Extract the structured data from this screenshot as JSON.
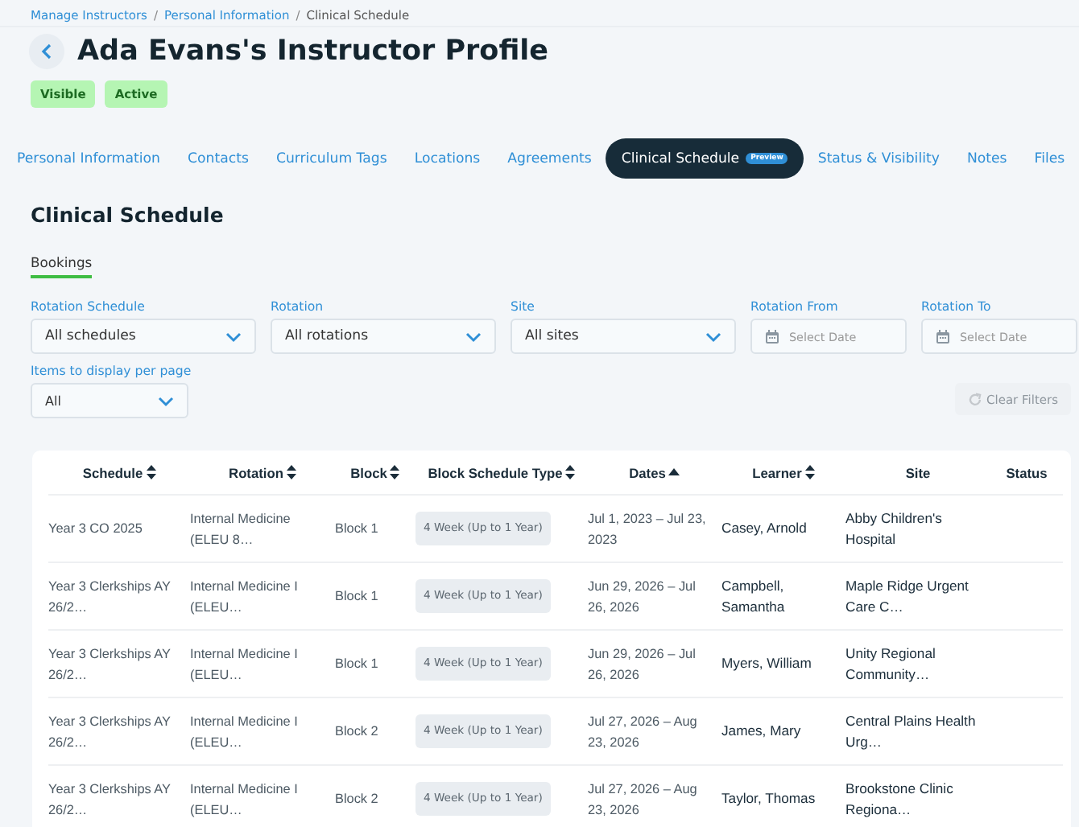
{
  "breadcrumbs": [
    {
      "kind": "link",
      "label": "Manage Instructors"
    },
    {
      "kind": "separator",
      "label": "/"
    },
    {
      "kind": "link",
      "label": "Personal Information"
    },
    {
      "kind": "separator",
      "label": "/"
    },
    {
      "kind": "current",
      "label": "Clinical Schedule"
    }
  ],
  "page_title": "Ada Evans's Instructor Profile",
  "badges": [
    "Visible",
    "Active"
  ],
  "tabs": [
    {
      "label": "Personal Information",
      "selected": false
    },
    {
      "label": "Contacts",
      "selected": false
    },
    {
      "label": "Curriculum Tags",
      "selected": false
    },
    {
      "label": "Locations",
      "selected": false
    },
    {
      "label": "Agreements",
      "selected": false
    },
    {
      "label": "Clinical Schedule",
      "selected": true,
      "tag": "Preview"
    },
    {
      "label": "Status & Visibility",
      "selected": false
    },
    {
      "label": "Notes",
      "selected": false
    },
    {
      "label": "Files",
      "selected": false
    }
  ],
  "section_title": "Clinical Schedule",
  "subtabs": [
    {
      "label": "Bookings",
      "selected": true
    }
  ],
  "filters": [
    {
      "kind": "select",
      "label": "Rotation Schedule",
      "value": "All schedules"
    },
    {
      "kind": "select",
      "label": "Rotation",
      "value": "All rotations"
    },
    {
      "kind": "select",
      "label": "Site",
      "value": "All sites"
    },
    {
      "kind": "date",
      "label": "Rotation From",
      "placeholder": "Select Date"
    },
    {
      "kind": "date",
      "label": "Rotation To",
      "placeholder": "Select Date"
    }
  ],
  "per_page": {
    "label": "Items to display per page",
    "value": "All"
  },
  "clear_filters": {
    "label": "Clear Filters",
    "disabled": true
  },
  "table": {
    "columns": [
      {
        "label": "Schedule",
        "sortable": true,
        "sorted": false
      },
      {
        "label": "Rotation",
        "sortable": true,
        "sorted": false
      },
      {
        "label": "Block",
        "sortable": true,
        "sorted": false
      },
      {
        "label": "Block Schedule Type",
        "sortable": true,
        "sorted": false
      },
      {
        "label": "Dates",
        "sortable": true,
        "sorted": true
      },
      {
        "label": "Learner",
        "sortable": true,
        "sorted": false
      },
      {
        "label": "Site",
        "sortable": false
      },
      {
        "label": "Status",
        "sortable": false
      }
    ],
    "rows": [
      {
        "schedule": "Year 3 CO 2025",
        "rotation": "Internal Medicine (ELEU 8…",
        "block": "Block 1",
        "type": "4 Week (Up to 1 Year)",
        "dates": "Jul 1, 2023 – Jul 23, 2023",
        "learner": "Casey, Arnold",
        "site": "Abby Children's Hospital"
      },
      {
        "schedule": "Year 3 Clerkships AY 26/2…",
        "rotation": "Internal Medicine I (ELEU…",
        "block": "Block 1",
        "type": "4 Week (Up to 1 Year)",
        "dates": "Jun 29, 2026 – Jul 26, 2026",
        "learner": "Campbell, Samantha",
        "site": "Maple Ridge Urgent Care C…"
      },
      {
        "schedule": "Year 3 Clerkships AY 26/2…",
        "rotation": "Internal Medicine I (ELEU…",
        "block": "Block 1",
        "type": "4 Week (Up to 1 Year)",
        "dates": "Jun 29, 2026 – Jul 26, 2026",
        "learner": "Myers, William",
        "site": "Unity Regional Community…"
      },
      {
        "schedule": "Year 3 Clerkships AY 26/2…",
        "rotation": "Internal Medicine I (ELEU…",
        "block": "Block 2",
        "type": "4 Week (Up to 1 Year)",
        "dates": "Jul 27, 2026 – Aug 23, 2026",
        "learner": "James, Mary",
        "site": "Central Plains Health Urg…"
      },
      {
        "schedule": "Year 3 Clerkships AY 26/2…",
        "rotation": "Internal Medicine I (ELEU…",
        "block": "Block 2",
        "type": "4 Week (Up to 1 Year)",
        "dates": "Jul 27, 2026 – Aug 23, 2026",
        "learner": "Taylor, Thomas",
        "site": "Brookstone Clinic Regiona…"
      }
    ]
  }
}
